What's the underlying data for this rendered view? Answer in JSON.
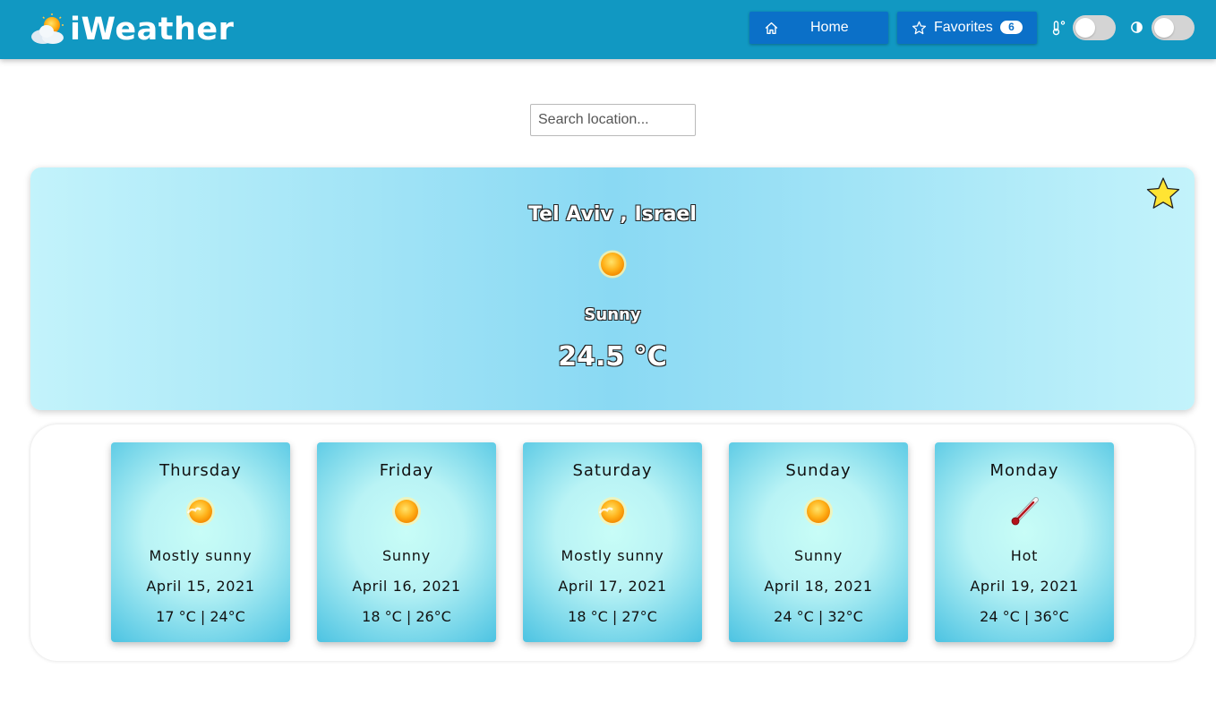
{
  "header": {
    "brand": "iWeather",
    "home_label": "Home",
    "favorites_label": "Favorites",
    "favorites_count": "6"
  },
  "search": {
    "placeholder": "Search location..."
  },
  "current": {
    "city": "Tel Aviv , Israel",
    "description": "Sunny",
    "temperature": "24.5 °C",
    "icon": "sun-icon"
  },
  "forecast": [
    {
      "day": "Thursday",
      "description": "Mostly sunny",
      "date": "April 15, 2021",
      "range": "17 °C | 24°C",
      "icon": "mostly-sunny-icon"
    },
    {
      "day": "Friday",
      "description": "Sunny",
      "date": "April 16, 2021",
      "range": "18 °C | 26°C",
      "icon": "sun-icon"
    },
    {
      "day": "Saturday",
      "description": "Mostly sunny",
      "date": "April 17, 2021",
      "range": "18 °C | 27°C",
      "icon": "mostly-sunny-icon"
    },
    {
      "day": "Sunday",
      "description": "Sunny",
      "date": "April 18, 2021",
      "range": "24 °C | 32°C",
      "icon": "sun-icon"
    },
    {
      "day": "Monday",
      "description": "Hot",
      "date": "April 19, 2021",
      "range": "24 °C | 36°C",
      "icon": "thermometer-icon"
    }
  ],
  "colors": {
    "navbar": "#1198c2",
    "button": "#0b70c8"
  }
}
